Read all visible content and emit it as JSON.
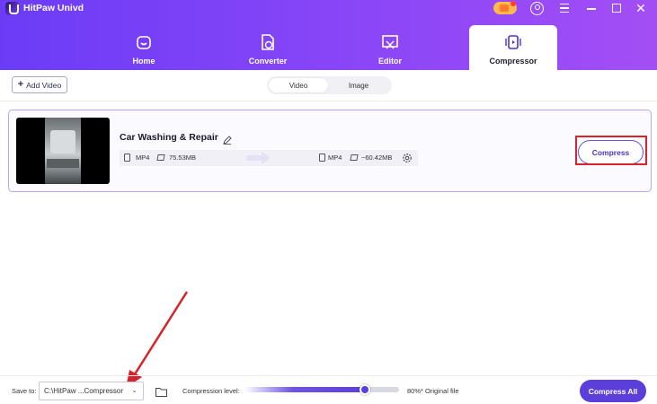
{
  "app": {
    "title": "HitPaw Univd"
  },
  "tabs": [
    {
      "label": "Home",
      "active": false
    },
    {
      "label": "Converter",
      "active": false
    },
    {
      "label": "Editor",
      "active": false
    },
    {
      "label": "Compressor",
      "active": true
    }
  ],
  "toolbar": {
    "add_video_label": "Add Video",
    "segments": [
      {
        "label": "Video",
        "selected": true
      },
      {
        "label": "Image",
        "selected": false
      }
    ]
  },
  "item": {
    "title": "Car Washing & Repair",
    "source_format": "MP4",
    "source_size": "75.53MB",
    "target_format": "MP4",
    "target_size": "~60.42MB",
    "compress_label": "Compress"
  },
  "footer": {
    "save_to_label": "Save to:",
    "save_path": "C:\\HitPaw ...Compressor",
    "compression_level_label": "Compression level:",
    "compression_level_text": "80%* Original file",
    "compression_level_fraction": 0.78,
    "compress_all_label": "Compress All"
  },
  "colors": {
    "accent": "#5b3fdb",
    "header_gradient_start": "#6b3cf6",
    "header_gradient_end": "#a34ef5",
    "highlight_annotation": "#d8232a"
  },
  "icons": [
    "app-logo-icon",
    "gift-icon",
    "user-icon",
    "menu-icon",
    "minimize-icon",
    "maximize-icon",
    "close-icon",
    "home-icon",
    "converter-icon",
    "editor-icon",
    "compressor-icon",
    "plus-icon",
    "edit-icon",
    "file-icon",
    "size-icon",
    "arrow-right-icon",
    "gear-icon",
    "chevron-down-icon",
    "folder-icon"
  ]
}
